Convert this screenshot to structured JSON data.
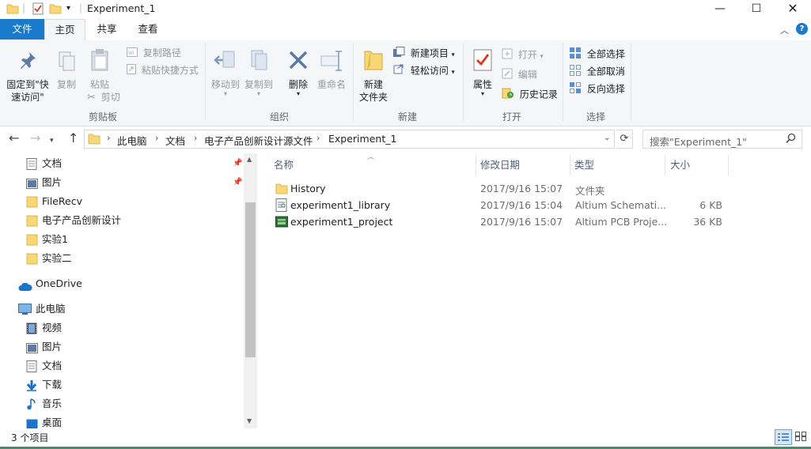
{
  "window": {
    "title": "Experiment_1"
  },
  "tabs": [
    {
      "label": "文件"
    },
    {
      "label": "主页"
    },
    {
      "label": "共享"
    },
    {
      "label": "查看"
    }
  ],
  "ribbon": {
    "clipboard": {
      "pin_line1": "固定到\"快",
      "pin_line2": "速访问\"",
      "copy": "复制",
      "paste": "粘贴",
      "copy_path": "复制路径",
      "paste_shortcut": "粘贴快捷方式",
      "cut": "剪切",
      "label": "剪贴板"
    },
    "organize": {
      "move_to": "移动到",
      "copy_to": "复制到",
      "delete": "删除",
      "rename": "重命名",
      "label": "组织"
    },
    "new": {
      "new_folder_line1": "新建",
      "new_folder_line2": "文件夹",
      "new_item": "新建项目",
      "easy_access": "轻松访问",
      "label": "新建"
    },
    "open": {
      "properties": "属性",
      "open": "打开",
      "edit": "编辑",
      "history": "历史记录",
      "label": "打开"
    },
    "select": {
      "select_all": "全部选择",
      "select_none": "全部取消",
      "invert": "反向选择",
      "label": "选择"
    }
  },
  "address": {
    "crumbs": [
      "此电脑",
      "文档",
      "电子产品创新设计源文件",
      "Experiment_1"
    ],
    "search_placeholder": "搜索\"Experiment_1\""
  },
  "nav": {
    "quick": [
      {
        "label": "文档",
        "icon": "documents-icon",
        "pinned": true
      },
      {
        "label": "图片",
        "icon": "pictures-icon",
        "pinned": true
      },
      {
        "label": "FileRecv",
        "icon": "folder-icon"
      },
      {
        "label": "电子产品创新设计",
        "icon": "folder-icon"
      },
      {
        "label": "实验1",
        "icon": "folder-icon"
      },
      {
        "label": "实验二",
        "icon": "folder-icon"
      }
    ],
    "onedrive": "OneDrive",
    "thispc": "此电脑",
    "pc_items": [
      {
        "label": "视频",
        "icon": "videos-icon"
      },
      {
        "label": "图片",
        "icon": "pictures-icon"
      },
      {
        "label": "文档",
        "icon": "documents-icon"
      },
      {
        "label": "下载",
        "icon": "downloads-icon"
      },
      {
        "label": "音乐",
        "icon": "music-icon"
      },
      {
        "label": "桌面",
        "icon": "desktop-icon"
      }
    ]
  },
  "columns": {
    "name": "名称",
    "date": "修改日期",
    "type": "类型",
    "size": "大小"
  },
  "files": [
    {
      "name": "History",
      "date": "2017/9/16 15:07",
      "type": "文件夹",
      "size": "",
      "icon": "folder-icon"
    },
    {
      "name": "experiment1_library",
      "date": "2017/9/16 15:04",
      "type": "Altium Schemati...",
      "size": "6 KB",
      "icon": "schematic-file-icon"
    },
    {
      "name": "experiment1_project",
      "date": "2017/9/16 15:07",
      "type": "Altium PCB Proje...",
      "size": "36 KB",
      "icon": "pcb-project-icon"
    }
  ],
  "status": {
    "count": "3 个项目"
  },
  "colors": {
    "file_tab": "#1979ca",
    "ribbon_bg": "#f5f6f7",
    "folder": "#f8d775",
    "header_text": "#4c607a"
  }
}
